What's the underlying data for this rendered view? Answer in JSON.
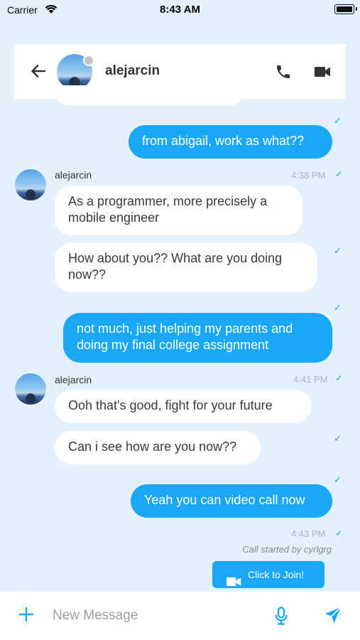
{
  "status_bar": {
    "carrier": "Carrier",
    "time": "8:43 AM"
  },
  "header": {
    "contact_name": "alejarcin",
    "icons": {
      "back": "arrow-left-icon",
      "call": "phone-icon",
      "video": "video-camera-icon"
    }
  },
  "messages": [
    {
      "side": "out",
      "text": "from abigail, work as what??",
      "read": true
    },
    {
      "side": "in",
      "sender": "alejarcin",
      "time": "4:38 PM",
      "text": "As a programmer, more precisely a mobile engineer",
      "read": true
    },
    {
      "side": "in",
      "text": "How about you?? What are you doing now??",
      "read": true
    },
    {
      "side": "out",
      "text": "not much, just helping my parents and doing my final college assignment",
      "read": true
    },
    {
      "side": "in",
      "sender": "alejarcin",
      "time": "4:41 PM",
      "text": "Ooh that's good, fight for your future",
      "read": true
    },
    {
      "side": "in",
      "text": "Can i see how are you now??",
      "read": true
    },
    {
      "side": "out",
      "text": "Yeah you can video call now",
      "read": true
    }
  ],
  "call": {
    "time": "4:43 PM",
    "note": "Call started by cyrlgrg",
    "join_label": "Click to Join!"
  },
  "input_bar": {
    "placeholder": "New Message",
    "icons": {
      "add": "plus-icon",
      "mic": "microphone-icon",
      "send": "send-icon"
    }
  },
  "colors": {
    "accent": "#1aa7f5",
    "background": "#e3f1fd",
    "bubble_in": "#ffffff",
    "presence": "#c4c4c4"
  }
}
